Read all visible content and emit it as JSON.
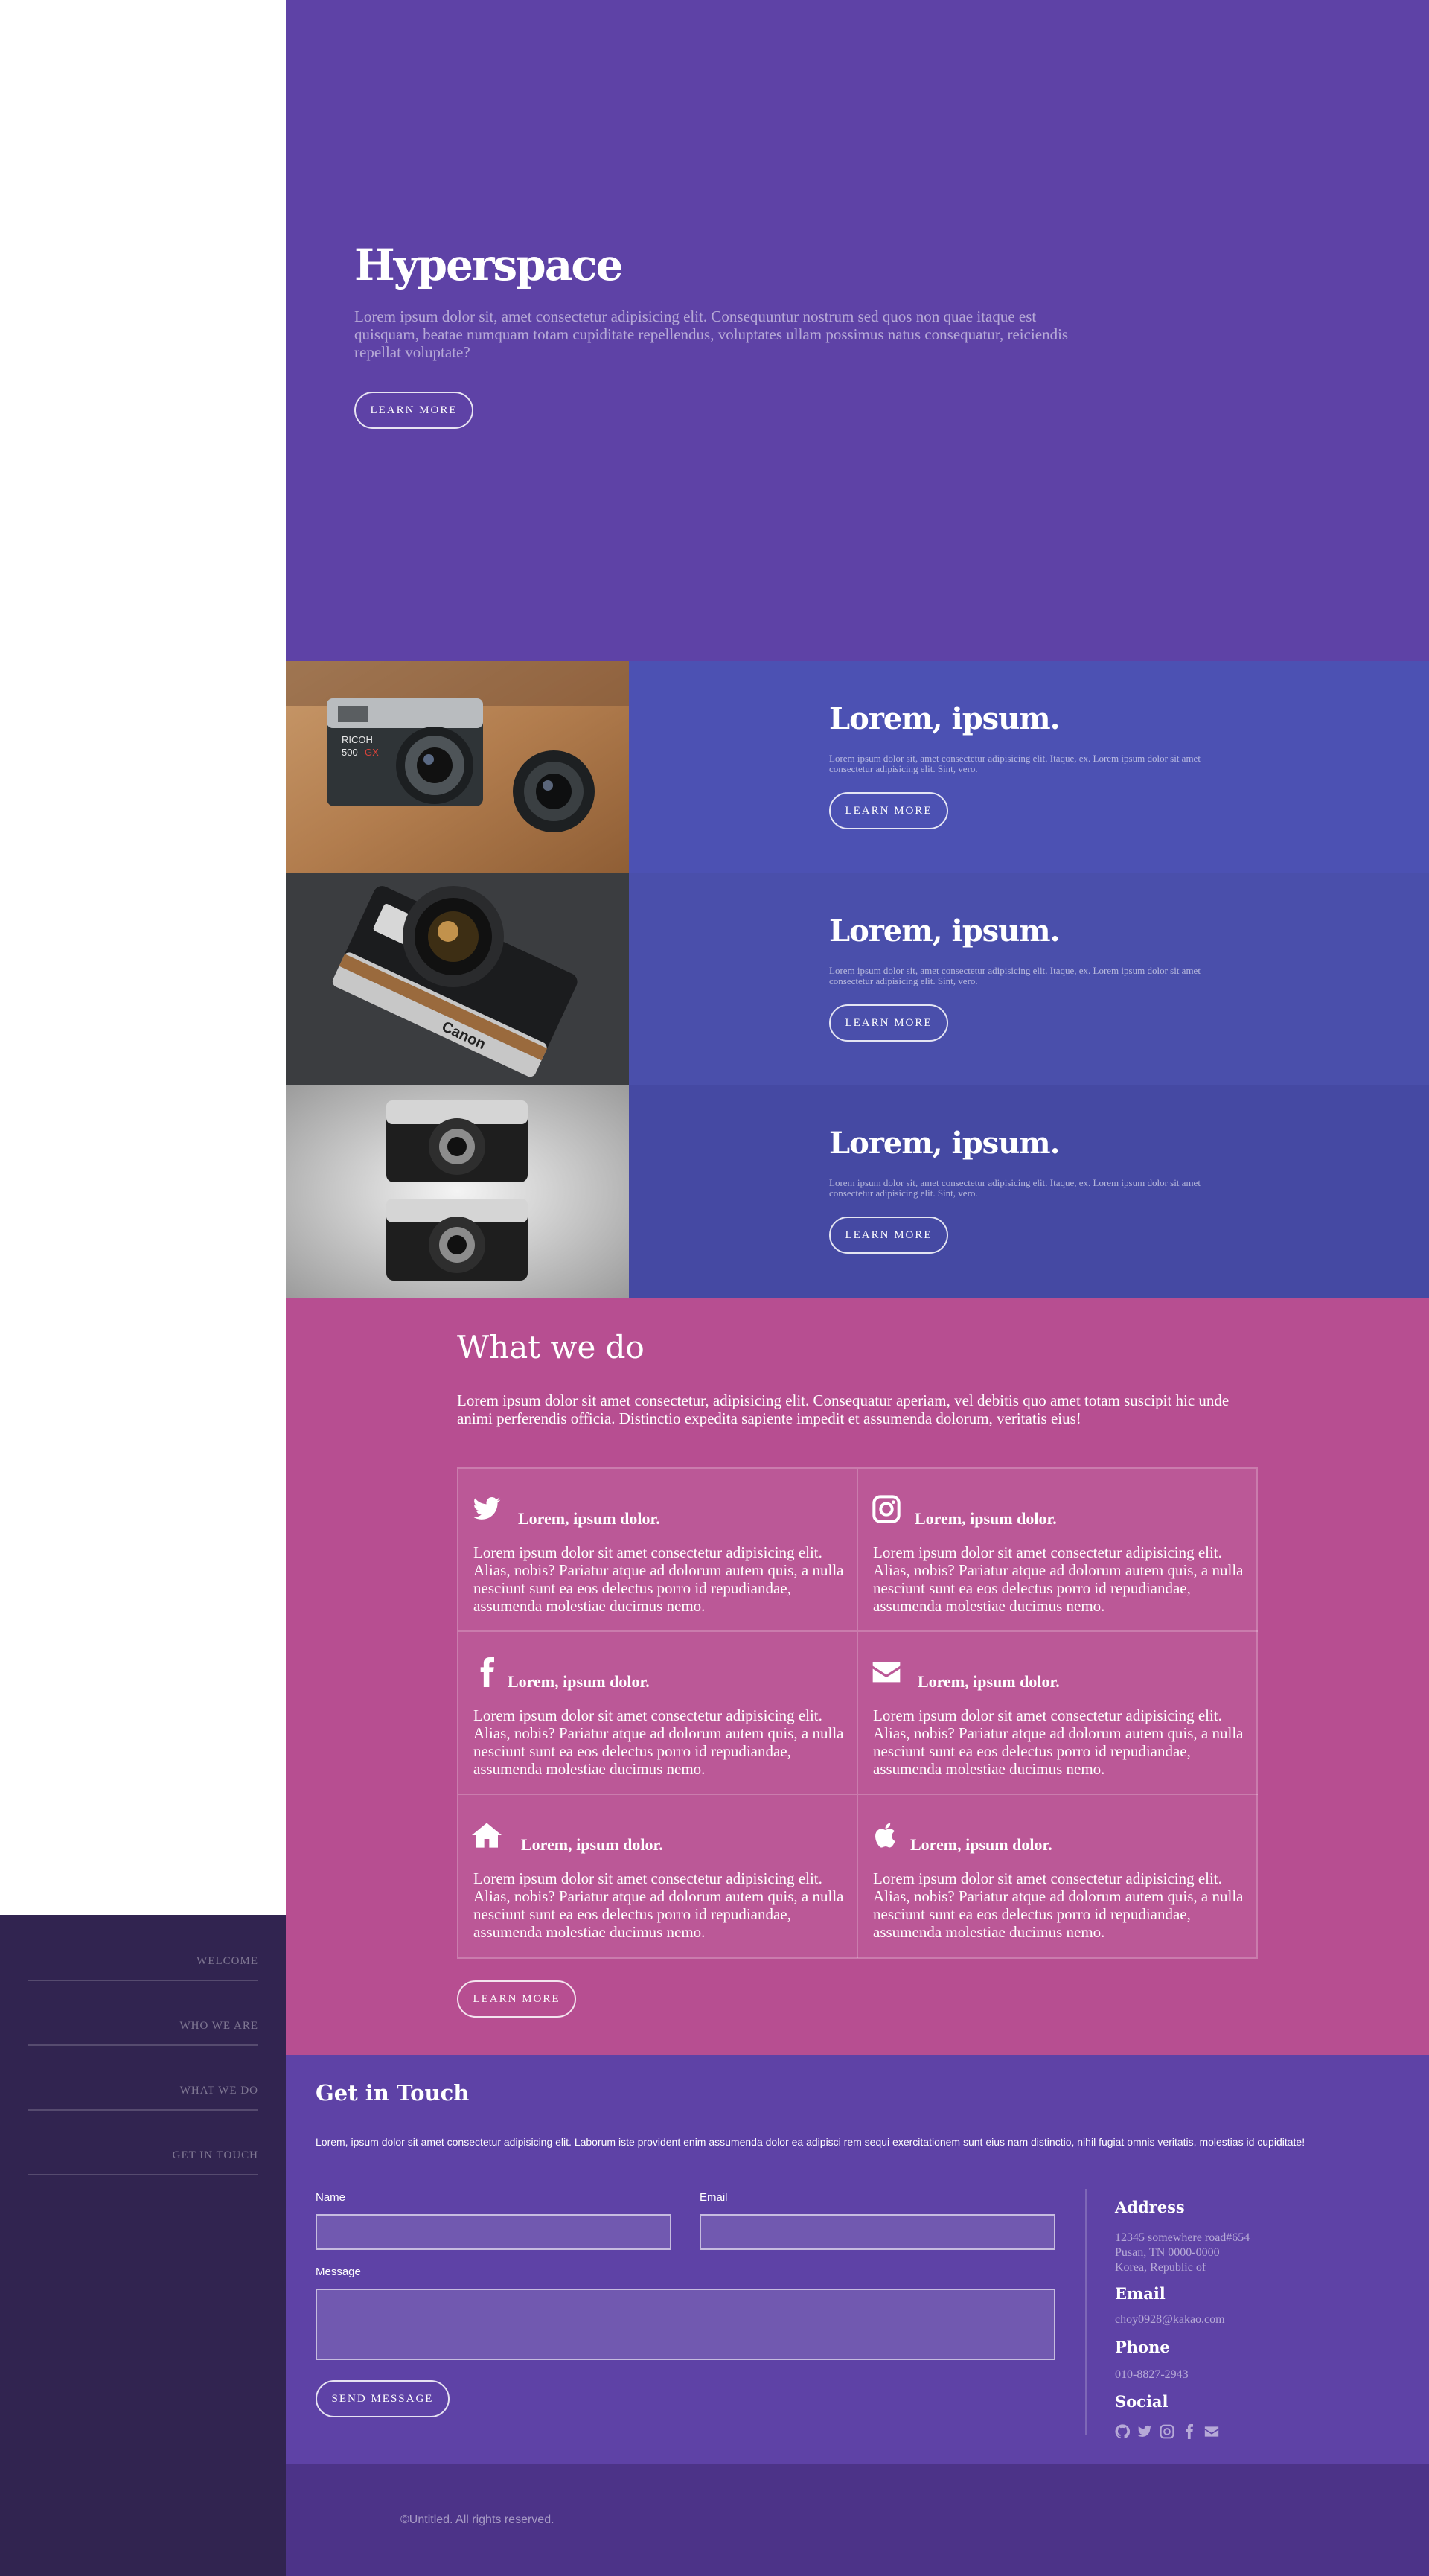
{
  "colors": {
    "hero_bg": "#5e42a6",
    "spotlight_1": "#4c51b3",
    "spotlight_2": "#4a4fab",
    "spotlight_3": "#4549a3",
    "what_bg": "#b74e91",
    "sidebar_bg": "#312450",
    "footer_bg": "#4c3388"
  },
  "sidebar": {
    "items": [
      {
        "label": "WELCOME"
      },
      {
        "label": "WHO WE ARE"
      },
      {
        "label": "WHAT WE DO"
      },
      {
        "label": "GET IN TOUCH"
      }
    ]
  },
  "hero": {
    "title": "Hyperspace",
    "text": "Lorem ipsum dolor sit, amet consectetur adipisicing elit. Consequuntur nostrum sed quos non quae itaque est quisquam, beatae numquam totam cupiditate repellendus, voluptates ullam possimus natus consequatur, reiciendis repellat voluptate?",
    "button": "LEARN MORE"
  },
  "spotlights": [
    {
      "title": "Lorem, ipsum.",
      "text": "Lorem ipsum dolor sit, amet consectetur adipisicing elit. Itaque, ex. Lorem ipsum dolor sit amet consectetur adipisicing elit. Sint, vero.",
      "button": "LEARN MORE",
      "image": "ricoh-camera-with-lens"
    },
    {
      "title": "Lorem, ipsum.",
      "text": "Lorem ipsum dolor sit, amet consectetur adipisicing elit. Itaque, ex. Lorem ipsum dolor sit amet consectetur adipisicing elit. Sint, vero.",
      "button": "LEARN MORE",
      "image": "canon-camera"
    },
    {
      "title": "Lorem, ipsum.",
      "text": "Lorem ipsum dolor sit, amet consectetur adipisicing elit. Itaque, ex. Lorem ipsum dolor sit amet consectetur adipisicing elit. Sint, vero.",
      "button": "LEARN MORE",
      "image": "two-vintage-cameras"
    }
  ],
  "what": {
    "title": "What we do",
    "intro": "Lorem ipsum dolor sit amet consectetur, adipisicing elit. Consequatur aperiam, vel debitis quo amet totam suscipit hic unde animi perferendis officia. Distinctio expedita sapiente impedit et assumenda dolorum, veritatis eius!",
    "features": [
      {
        "icon": "twitter-icon",
        "title": "Lorem, ipsum dolor.",
        "text": "Lorem ipsum dolor sit amet consectetur adipisicing elit. Alias, nobis? Pariatur atque ad dolorum autem quis, a nulla nesciunt sunt ea eos delectus porro id repudiandae, assumenda molestiae ducimus nemo."
      },
      {
        "icon": "instagram-icon",
        "title": "Lorem, ipsum dolor.",
        "text": "Lorem ipsum dolor sit amet consectetur adipisicing elit. Alias, nobis? Pariatur atque ad dolorum autem quis, a nulla nesciunt sunt ea eos delectus porro id repudiandae, assumenda molestiae ducimus nemo."
      },
      {
        "icon": "facebook-icon",
        "title": "Lorem, ipsum dolor.",
        "text": "Lorem ipsum dolor sit amet consectetur adipisicing elit. Alias, nobis? Pariatur atque ad dolorum autem quis, a nulla nesciunt sunt ea eos delectus porro id repudiandae, assumenda molestiae ducimus nemo."
      },
      {
        "icon": "envelope-icon",
        "title": "Lorem, ipsum dolor.",
        "text": "Lorem ipsum dolor sit amet consectetur adipisicing elit. Alias, nobis? Pariatur atque ad dolorum autem quis, a nulla nesciunt sunt ea eos delectus porro id repudiandae, assumenda molestiae ducimus nemo."
      },
      {
        "icon": "home-icon",
        "title": "Lorem, ipsum dolor.",
        "text": "Lorem ipsum dolor sit amet consectetur adipisicing elit. Alias, nobis? Pariatur atque ad dolorum autem quis, a nulla nesciunt sunt ea eos delectus porro id repudiandae, assumenda molestiae ducimus nemo."
      },
      {
        "icon": "apple-icon",
        "title": "Lorem, ipsum dolor.",
        "text": "Lorem ipsum dolor sit amet consectetur adipisicing elit. Alias, nobis? Pariatur atque ad dolorum autem quis, a nulla nesciunt sunt ea eos delectus porro id repudiandae, assumenda molestiae ducimus nemo."
      }
    ],
    "button": "LEARN MORE"
  },
  "contact": {
    "title": "Get in Touch",
    "text": "Lorem, ipsum dolor sit amet consectetur adipisicing elit. Laborum iste provident enim assumenda dolor ea adipisci rem sequi exercitationem sunt eius nam distinctio, nihil fugiat omnis veritatis, molestias id cupiditate!",
    "name_label": "Name",
    "name_value": "",
    "email_label": "Email",
    "email_value": "",
    "message_label": "Message",
    "message_value": "",
    "send_button": "SEND MESSAGE",
    "address_title": "Address",
    "address_lines": [
      "12345 somewhere road#654",
      "Pusan, TN 0000-0000",
      "Korea, Republic of"
    ],
    "email_title": "Email",
    "email": "choy0928@kakao.com",
    "phone_title": "Phone",
    "phone": "010-8827-2943",
    "social_title": "Social",
    "socials": [
      "github-icon",
      "twitter-icon",
      "instagram-icon",
      "facebook-icon",
      "envelope-icon"
    ]
  },
  "footer": {
    "copyright": "©Untitled. All rights reserved."
  }
}
